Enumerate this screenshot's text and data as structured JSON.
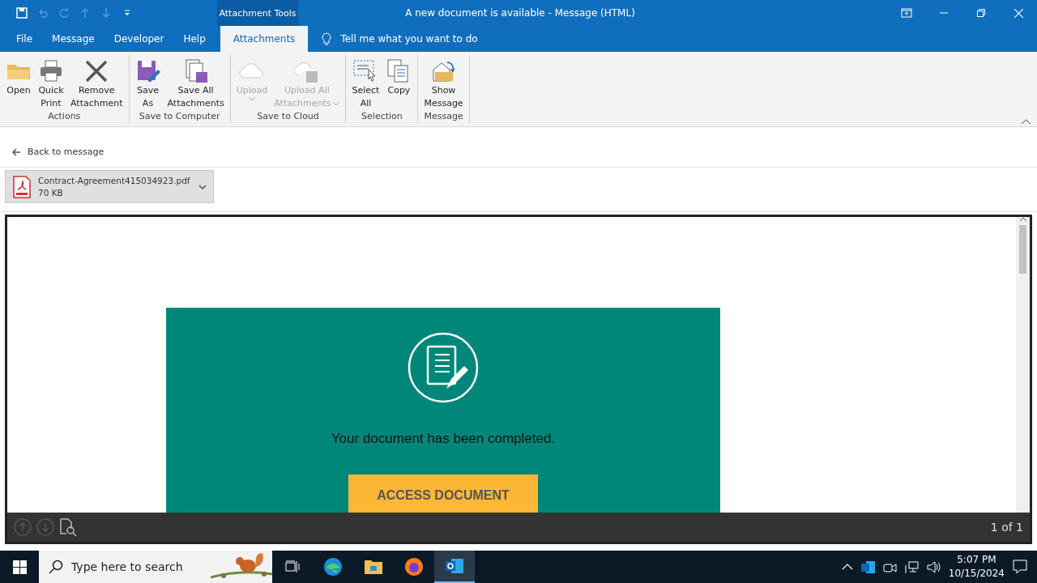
{
  "window": {
    "title": "A new document is available  -  Message (HTML)",
    "context_tab": "Attachment Tools"
  },
  "tabs": [
    {
      "label": "File",
      "selected": false
    },
    {
      "label": "Message",
      "selected": false
    },
    {
      "label": "Developer",
      "selected": false
    },
    {
      "label": "Help",
      "selected": false
    },
    {
      "label": "Attachments",
      "selected": true
    }
  ],
  "tell_me": {
    "placeholder": "Tell me what you want to do"
  },
  "ribbon_groups": [
    {
      "label": "Actions",
      "buttons": [
        {
          "lines": [
            "Open"
          ],
          "disabled": false,
          "dropdown": false
        },
        {
          "lines": [
            "Quick",
            "Print"
          ],
          "disabled": false,
          "dropdown": false
        },
        {
          "lines": [
            "Remove",
            "Attachment"
          ],
          "disabled": false,
          "dropdown": false
        }
      ]
    },
    {
      "label": "Save to Computer",
      "buttons": [
        {
          "lines": [
            "Save",
            "As"
          ],
          "disabled": false,
          "dropdown": false
        },
        {
          "lines": [
            "Save All",
            "Attachments"
          ],
          "disabled": false,
          "dropdown": false
        }
      ]
    },
    {
      "label": "Save to Cloud",
      "buttons": [
        {
          "lines": [
            "Upload"
          ],
          "disabled": true,
          "dropdown": true
        },
        {
          "lines": [
            "Upload All",
            "Attachments"
          ],
          "disabled": true,
          "dropdown": true
        }
      ]
    },
    {
      "label": "Selection",
      "buttons": [
        {
          "lines": [
            "Select",
            "All"
          ],
          "disabled": false,
          "dropdown": false
        },
        {
          "lines": [
            "Copy"
          ],
          "disabled": false,
          "dropdown": false
        }
      ]
    },
    {
      "label": "Message",
      "buttons": [
        {
          "lines": [
            "Show",
            "Message"
          ],
          "disabled": false,
          "dropdown": false
        }
      ]
    }
  ],
  "back_link": "Back to message",
  "attachment": {
    "name": "Contract-Agreement415034923.pdf",
    "size": "70 KB"
  },
  "email": {
    "message": "Your document has been completed.",
    "button": "ACCESS DOCUMENT"
  },
  "preview_bar": {
    "page_count": "1 of 1"
  },
  "taskbar": {
    "search": {
      "placeholder": "Type here to search"
    },
    "time": "5:07 PM",
    "date": "10/15/2024"
  }
}
